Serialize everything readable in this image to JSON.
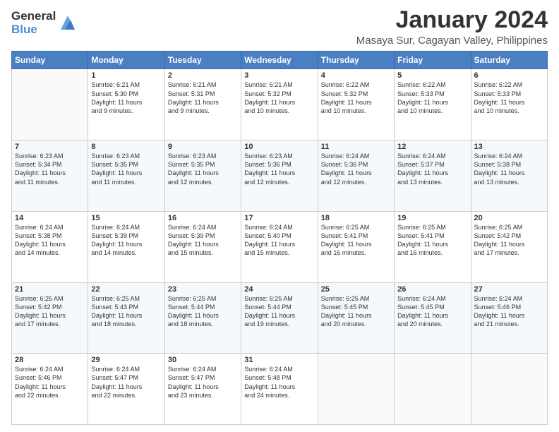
{
  "logo": {
    "general": "General",
    "blue": "Blue"
  },
  "title": "January 2024",
  "subtitle": "Masaya Sur, Cagayan Valley, Philippines",
  "days": [
    "Sunday",
    "Monday",
    "Tuesday",
    "Wednesday",
    "Thursday",
    "Friday",
    "Saturday"
  ],
  "weeks": [
    [
      {
        "day": "",
        "info": ""
      },
      {
        "day": "1",
        "info": "Sunrise: 6:21 AM\nSunset: 5:30 PM\nDaylight: 11 hours\nand 9 minutes."
      },
      {
        "day": "2",
        "info": "Sunrise: 6:21 AM\nSunset: 5:31 PM\nDaylight: 11 hours\nand 9 minutes."
      },
      {
        "day": "3",
        "info": "Sunrise: 6:21 AM\nSunset: 5:32 PM\nDaylight: 11 hours\nand 10 minutes."
      },
      {
        "day": "4",
        "info": "Sunrise: 6:22 AM\nSunset: 5:32 PM\nDaylight: 11 hours\nand 10 minutes."
      },
      {
        "day": "5",
        "info": "Sunrise: 6:22 AM\nSunset: 5:33 PM\nDaylight: 11 hours\nand 10 minutes."
      },
      {
        "day": "6",
        "info": "Sunrise: 6:22 AM\nSunset: 5:33 PM\nDaylight: 11 hours\nand 10 minutes."
      }
    ],
    [
      {
        "day": "7",
        "info": "Sunrise: 6:23 AM\nSunset: 5:34 PM\nDaylight: 11 hours\nand 11 minutes."
      },
      {
        "day": "8",
        "info": "Sunrise: 6:23 AM\nSunset: 5:35 PM\nDaylight: 11 hours\nand 11 minutes."
      },
      {
        "day": "9",
        "info": "Sunrise: 6:23 AM\nSunset: 5:35 PM\nDaylight: 11 hours\nand 12 minutes."
      },
      {
        "day": "10",
        "info": "Sunrise: 6:23 AM\nSunset: 5:36 PM\nDaylight: 11 hours\nand 12 minutes."
      },
      {
        "day": "11",
        "info": "Sunrise: 6:24 AM\nSunset: 5:36 PM\nDaylight: 11 hours\nand 12 minutes."
      },
      {
        "day": "12",
        "info": "Sunrise: 6:24 AM\nSunset: 5:37 PM\nDaylight: 11 hours\nand 13 minutes."
      },
      {
        "day": "13",
        "info": "Sunrise: 6:24 AM\nSunset: 5:38 PM\nDaylight: 11 hours\nand 13 minutes."
      }
    ],
    [
      {
        "day": "14",
        "info": "Sunrise: 6:24 AM\nSunset: 5:38 PM\nDaylight: 11 hours\nand 14 minutes."
      },
      {
        "day": "15",
        "info": "Sunrise: 6:24 AM\nSunset: 5:39 PM\nDaylight: 11 hours\nand 14 minutes."
      },
      {
        "day": "16",
        "info": "Sunrise: 6:24 AM\nSunset: 5:39 PM\nDaylight: 11 hours\nand 15 minutes."
      },
      {
        "day": "17",
        "info": "Sunrise: 6:24 AM\nSunset: 5:40 PM\nDaylight: 11 hours\nand 15 minutes."
      },
      {
        "day": "18",
        "info": "Sunrise: 6:25 AM\nSunset: 5:41 PM\nDaylight: 11 hours\nand 16 minutes."
      },
      {
        "day": "19",
        "info": "Sunrise: 6:25 AM\nSunset: 5:41 PM\nDaylight: 11 hours\nand 16 minutes."
      },
      {
        "day": "20",
        "info": "Sunrise: 6:25 AM\nSunset: 5:42 PM\nDaylight: 11 hours\nand 17 minutes."
      }
    ],
    [
      {
        "day": "21",
        "info": "Sunrise: 6:25 AM\nSunset: 5:42 PM\nDaylight: 11 hours\nand 17 minutes."
      },
      {
        "day": "22",
        "info": "Sunrise: 6:25 AM\nSunset: 5:43 PM\nDaylight: 11 hours\nand 18 minutes."
      },
      {
        "day": "23",
        "info": "Sunrise: 6:25 AM\nSunset: 5:44 PM\nDaylight: 11 hours\nand 18 minutes."
      },
      {
        "day": "24",
        "info": "Sunrise: 6:25 AM\nSunset: 5:44 PM\nDaylight: 11 hours\nand 19 minutes."
      },
      {
        "day": "25",
        "info": "Sunrise: 6:25 AM\nSunset: 5:45 PM\nDaylight: 11 hours\nand 20 minutes."
      },
      {
        "day": "26",
        "info": "Sunrise: 6:24 AM\nSunset: 5:45 PM\nDaylight: 11 hours\nand 20 minutes."
      },
      {
        "day": "27",
        "info": "Sunrise: 6:24 AM\nSunset: 5:46 PM\nDaylight: 11 hours\nand 21 minutes."
      }
    ],
    [
      {
        "day": "28",
        "info": "Sunrise: 6:24 AM\nSunset: 5:46 PM\nDaylight: 11 hours\nand 22 minutes."
      },
      {
        "day": "29",
        "info": "Sunrise: 6:24 AM\nSunset: 5:47 PM\nDaylight: 11 hours\nand 22 minutes."
      },
      {
        "day": "30",
        "info": "Sunrise: 6:24 AM\nSunset: 5:47 PM\nDaylight: 11 hours\nand 23 minutes."
      },
      {
        "day": "31",
        "info": "Sunrise: 6:24 AM\nSunset: 5:48 PM\nDaylight: 11 hours\nand 24 minutes."
      },
      {
        "day": "",
        "info": ""
      },
      {
        "day": "",
        "info": ""
      },
      {
        "day": "",
        "info": ""
      }
    ]
  ]
}
